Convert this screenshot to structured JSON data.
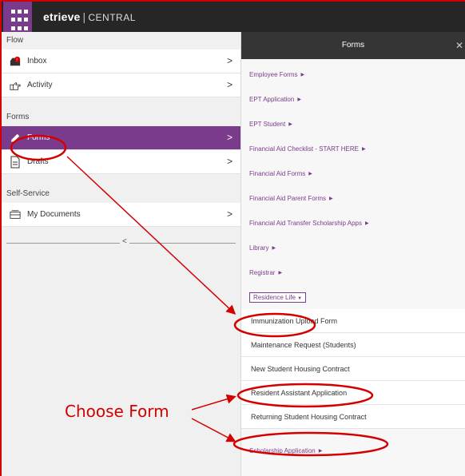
{
  "app": {
    "logo_brand": "etrieve",
    "logo_separator": "|",
    "logo_product": "CENTRAL"
  },
  "sidebar": {
    "sections": [
      {
        "label": "Flow",
        "items": [
          {
            "label": "Inbox",
            "icon": "inbox-alert-icon",
            "badge": "!"
          },
          {
            "label": "Activity",
            "icon": "pointing-hand-icon"
          }
        ]
      },
      {
        "label": "Forms",
        "items": [
          {
            "label": "Forms",
            "icon": "pencil-icon",
            "active": true
          },
          {
            "label": "Drafts",
            "icon": "document-icon"
          }
        ]
      },
      {
        "label": "Self-Service",
        "items": [
          {
            "label": "My Documents",
            "icon": "documents-tray-icon"
          }
        ]
      }
    ],
    "collapse_glyph": "<"
  },
  "forms_panel": {
    "title": "Forms",
    "close_glyph": "✕",
    "folders": [
      {
        "label": "Employee Forms"
      },
      {
        "label": "EPT Application"
      },
      {
        "label": "EPT Student"
      },
      {
        "label": "Financial Aid Checklist - START HERE"
      },
      {
        "label": "Financial Aid Forms"
      },
      {
        "label": "Financial Aid Parent Forms"
      },
      {
        "label": "Financial Aid Transfer Scholarship Apps"
      },
      {
        "label": "Library"
      },
      {
        "label": "Registrar"
      }
    ],
    "open_folder": {
      "label": "Residence Life",
      "items": [
        "Immunization Upload Form",
        "Maintenance Request (Students)",
        "New Student Housing Contract",
        "Resident Assistant Application",
        "Returning Student Housing Contract"
      ]
    },
    "after_folders": [
      {
        "label": "Scholarship Application"
      }
    ]
  },
  "annotation": {
    "callout": "Choose Form",
    "color": "#d40000"
  },
  "colors": {
    "accent": "#7b3b8c",
    "topbar": "#262626",
    "panel_header": "#353535"
  }
}
